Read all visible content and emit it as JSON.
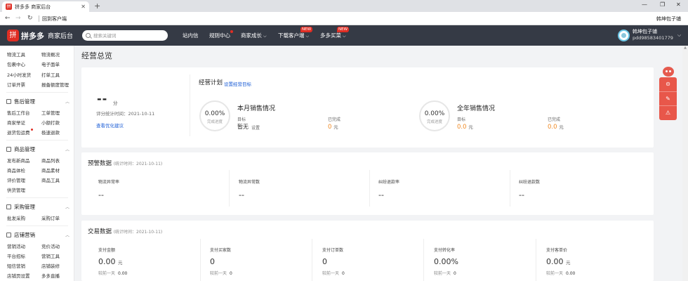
{
  "browser": {
    "tab_title": "拼多多 商家后台",
    "tab_icon": "拼",
    "address_text": "回到客户端",
    "right_text": "韩坤包子铺",
    "controls": {
      "minimize": "—",
      "restore": "❐",
      "close": "✕"
    }
  },
  "header": {
    "logo_mark": "拼",
    "logo_name": "拼多多",
    "logo_sub": "商家后台",
    "search_placeholder": "搜索关键词",
    "nav": [
      {
        "label": "站内信"
      },
      {
        "label": "规则中心"
      },
      {
        "label": "商家成长"
      },
      {
        "label": "下载客户端",
        "badge": "NEW"
      },
      {
        "label": "多多买菜",
        "badge": "NEW"
      }
    ],
    "user_name": "韩坤包子铺",
    "user_id": "pdd98583401779"
  },
  "sidebar": {
    "top_rows": [
      [
        "物流工具",
        "物流概况"
      ],
      [
        "包裹中心",
        "电子面单"
      ],
      [
        "24小时发货",
        "打单工具"
      ],
      [
        "订单开票",
        "报备额度管理"
      ]
    ],
    "sections": [
      {
        "title": "售后管理",
        "rows": [
          [
            "售后工作台",
            "工单管理"
          ],
          [
            "商家举证",
            "小额打款"
          ],
          [
            "退货包运费",
            "极速退款"
          ]
        ]
      },
      {
        "title": "商品管理",
        "rows": [
          [
            "发布新商品",
            "商品列表"
          ],
          [
            "商品体检",
            "商品素材"
          ],
          [
            "评价管理",
            "商品工具"
          ],
          [
            "供货管理",
            ""
          ]
        ]
      },
      {
        "title": "采购管理",
        "rows": [
          [
            "批发采购",
            "采购订单"
          ]
        ]
      },
      {
        "title": "店铺营销",
        "rows": [
          [
            "营销活动",
            "竞价活动"
          ],
          [
            "平台招标",
            "营销工具"
          ],
          [
            "短信营销",
            "店铺装修"
          ],
          [
            "店铺页设置",
            "多多直播"
          ]
        ]
      }
    ]
  },
  "main": {
    "page_title": "经营总览",
    "overview": {
      "score": "--",
      "score_unit": "分",
      "score_time": "评分统计时间：2021-10-11",
      "score_link": "查看优化建议",
      "plan_title": "经营计划",
      "plan_link": "设置经营目标",
      "monthly": {
        "title": "本月销售情况",
        "pct": "0.00%",
        "pct_label": "完成进度",
        "target_label": "目标",
        "target_value": "暂无",
        "target_link": "设置",
        "done_label": "已完成",
        "done_value": "0",
        "done_unit": "元"
      },
      "yearly": {
        "title": "全年销售情况",
        "pct": "0.00%",
        "pct_label": "完成进度",
        "target_label": "目标",
        "target_value": "0.0",
        "target_unit": "元",
        "done_label": "已完成",
        "done_value": "0.0",
        "done_unit": "元"
      }
    },
    "alerts": {
      "title": "预警数据",
      "subtitle": "(统计时间：2021-10-11)",
      "items": [
        {
          "label": "物流异常率",
          "value": "--"
        },
        {
          "label": "物流异常数",
          "value": "--"
        },
        {
          "label": "纠纷退款率",
          "value": "--"
        },
        {
          "label": "纠纷退款数",
          "value": "--"
        }
      ]
    },
    "trade": {
      "title": "交易数据",
      "subtitle": "(统计时间：2021-10-11)",
      "compare_label": "较前一天",
      "items": [
        {
          "label": "支付金额",
          "value": "0.00",
          "unit": "元",
          "compare": "0.00"
        },
        {
          "label": "支付买家数",
          "value": "0",
          "unit": "",
          "compare": "0"
        },
        {
          "label": "支付订单数",
          "value": "0",
          "unit": "",
          "compare": "0"
        },
        {
          "label": "支付转化率",
          "value": "0.00%",
          "unit": "",
          "compare": "0"
        },
        {
          "label": "支付客单价",
          "value": "0.00",
          "unit": "元",
          "compare": "0.00"
        }
      ]
    }
  },
  "float_tools": [
    "⊝",
    "✎",
    "⚠"
  ],
  "colors": {
    "brand": "#e02e24",
    "header_bg": "#353a45",
    "orange": "#f08a24",
    "link": "#1e5fd6"
  }
}
